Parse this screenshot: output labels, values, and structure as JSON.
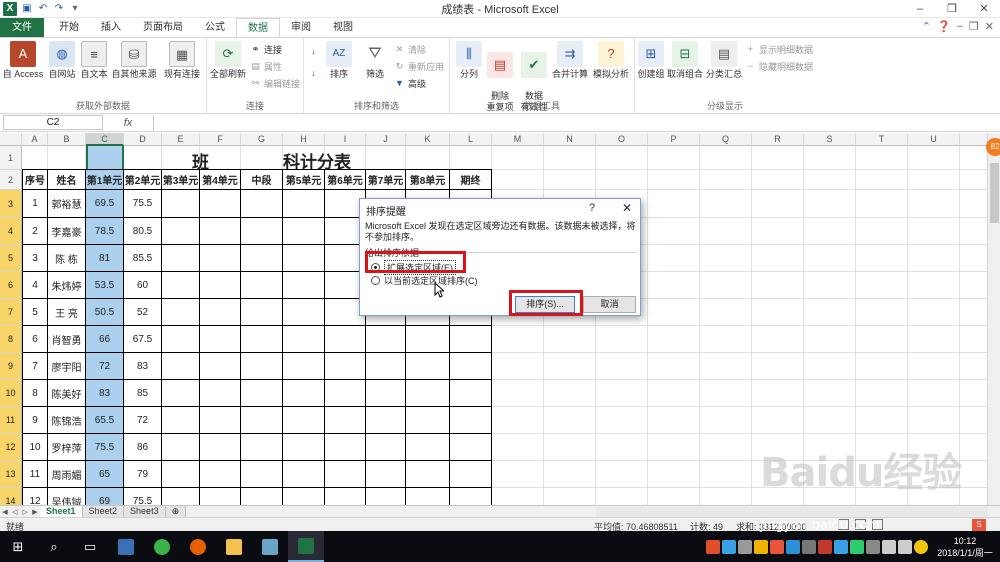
{
  "window": {
    "title": "成绩表 - Microsoft Excel",
    "controls": [
      "–",
      "❐",
      "✕"
    ]
  },
  "ribbon": {
    "tabs": [
      "文件",
      "开始",
      "插入",
      "页面布局",
      "公式",
      "数据",
      "审阅",
      "视图"
    ],
    "active_tab": "数据",
    "groups": {
      "external": {
        "label": "获取外部数据",
        "buttons": [
          "自 Access",
          "自网站",
          "自文本",
          "自其他来源",
          "现有连接"
        ]
      },
      "connections": {
        "label": "连接",
        "refresh": "全部刷新",
        "small": [
          "连接",
          "属性",
          "编辑链接"
        ]
      },
      "sort_filter": {
        "label": "排序和筛选",
        "sort": "排序",
        "filter": "筛选",
        "small": [
          "清除",
          "重新应用",
          "高级"
        ]
      },
      "data_tools": {
        "label": "数据工具",
        "buttons": [
          "分列",
          "删除\n重复项",
          "数据\n有效性",
          "合并计算",
          "模拟分析"
        ]
      },
      "outline": {
        "label": "分级显示",
        "buttons": [
          "创建组",
          "取消组合",
          "分类汇总"
        ],
        "small": [
          "显示明细数据",
          "隐藏明细数据"
        ]
      }
    }
  },
  "formula_bar": {
    "name_box": "C2",
    "fx": "fx",
    "formula": ""
  },
  "grid": {
    "columns": [
      "A",
      "B",
      "C",
      "D",
      "E",
      "F",
      "G",
      "H",
      "I",
      "J",
      "K",
      "L",
      "M",
      "N",
      "O",
      "P",
      "Q",
      "R",
      "S",
      "T",
      "U"
    ],
    "selected_column": "C",
    "title_left": "班",
    "title_right": "科计分表",
    "header_row": [
      "序号",
      "姓名",
      "第1单元",
      "第2单元",
      "第3单元",
      "第4单元",
      "中段",
      "第5单元",
      "第6单元",
      "第7单元",
      "第8单元",
      "期终"
    ],
    "rows": [
      {
        "n": "1",
        "name": "郭裕慧",
        "u1": "69.5",
        "u2": "75.5"
      },
      {
        "n": "2",
        "name": "李嘉豪",
        "u1": "78.5",
        "u2": "80.5"
      },
      {
        "n": "3",
        "name": "陈 栋",
        "u1": "81",
        "u2": "85.5"
      },
      {
        "n": "4",
        "name": "朱炜婷",
        "u1": "53.5",
        "u2": "60"
      },
      {
        "n": "5",
        "name": "王 亮",
        "u1": "50.5",
        "u2": "52"
      },
      {
        "n": "6",
        "name": "肖智勇",
        "u1": "66",
        "u2": "67.5"
      },
      {
        "n": "7",
        "name": "廖宇阳",
        "u1": "72",
        "u2": "83"
      },
      {
        "n": "8",
        "name": "陈美好",
        "u1": "83",
        "u2": "85"
      },
      {
        "n": "9",
        "name": "陈锦浩",
        "u1": "65.5",
        "u2": "72"
      },
      {
        "n": "10",
        "name": "罗梓萍",
        "u1": "75.5",
        "u2": "86"
      },
      {
        "n": "11",
        "name": "周雨媚",
        "u1": "65",
        "u2": "79"
      },
      {
        "n": "12",
        "name": "吴伟铖",
        "u1": "69",
        "u2": "75.5"
      }
    ],
    "row_numbers": [
      "1",
      "2",
      "3",
      "4",
      "5",
      "6",
      "7",
      "8",
      "9",
      "10",
      "11",
      "12",
      "13",
      "14"
    ]
  },
  "sheet_tabs": [
    "Sheet1",
    "Sheet2",
    "Sheet3"
  ],
  "active_sheet": "Sheet1",
  "status": {
    "ready": "就绪",
    "average": "平均值: 70.46808511",
    "count": "计数: 49",
    "sum": "求和: 3312.00000"
  },
  "dialog": {
    "title": "排序提醒",
    "help": "?",
    "close": "✕",
    "message": "Microsoft Excel 发现在选定区域旁边还有数据。该数据未被选择，将不参加排序。",
    "group_label": "给出排序依据",
    "option_expand": "扩展选定区域(E)",
    "option_current": "以当前选定区域排序(C)",
    "selected_option": "expand",
    "sort_button": "排序(S)...",
    "cancel_button": "取消"
  },
  "taskbar": {
    "time": "10:12",
    "date": "2018/1/1/周一"
  },
  "watermark": {
    "main": "Baidu经验",
    "sub": "jingyan.baidu.com"
  },
  "colors": {
    "excel_green": "#217346",
    "selection_blue": "#acd1ef",
    "row_highlight": "#f8d569",
    "annotation_red": "#d8151a"
  }
}
